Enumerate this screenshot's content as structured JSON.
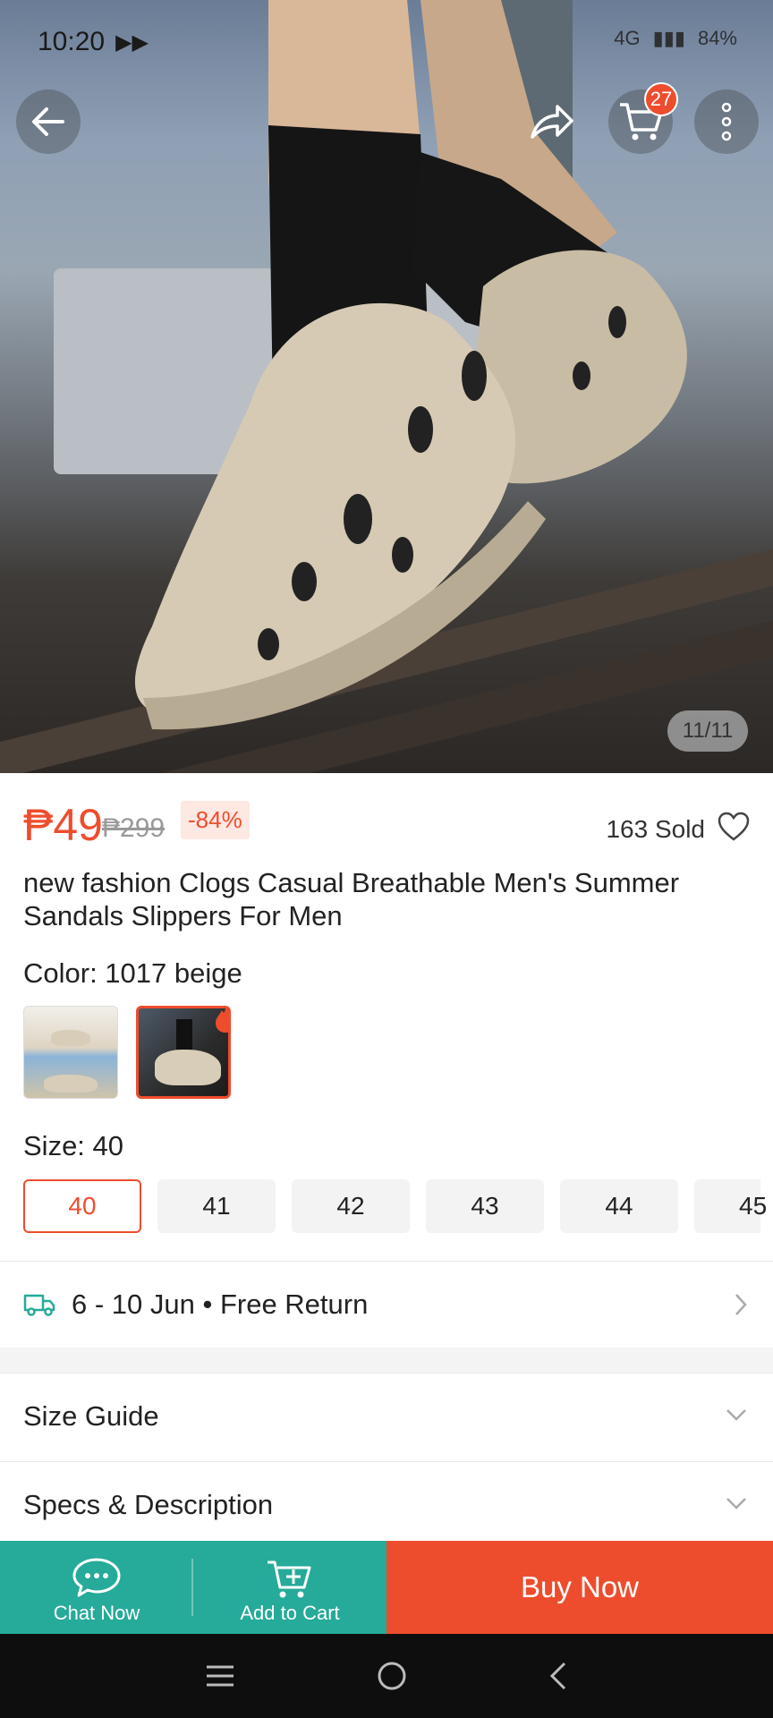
{
  "status_bar": {
    "time": "10:20",
    "network": "4G",
    "battery": "84%"
  },
  "header": {
    "cart_count": "27",
    "image_counter": "11/11"
  },
  "product": {
    "price": "₱49",
    "original_price": "₱299",
    "discount": "-84%",
    "sold": "163 Sold",
    "title": "new fashion Clogs Casual Breathable Men's Summer Sandals Slippers For Men"
  },
  "color": {
    "label": "Color: 1017 beige",
    "options": [
      "swatch-1",
      "swatch-2"
    ],
    "selected_index": 1
  },
  "size": {
    "label": "Size: 40",
    "options": [
      "40",
      "41",
      "42",
      "43",
      "44",
      "45"
    ],
    "selected": "40"
  },
  "delivery": {
    "text": "6 - 10 Jun • Free Return"
  },
  "accordions": [
    {
      "label": "Size Guide"
    },
    {
      "label": "Specs & Description"
    }
  ],
  "bottom_bar": {
    "chat_label": "Chat Now",
    "cart_label": "Add to Cart",
    "buy_label": "Buy Now"
  },
  "colors": {
    "accent": "#ee4d2d",
    "teal": "#26aa99"
  }
}
